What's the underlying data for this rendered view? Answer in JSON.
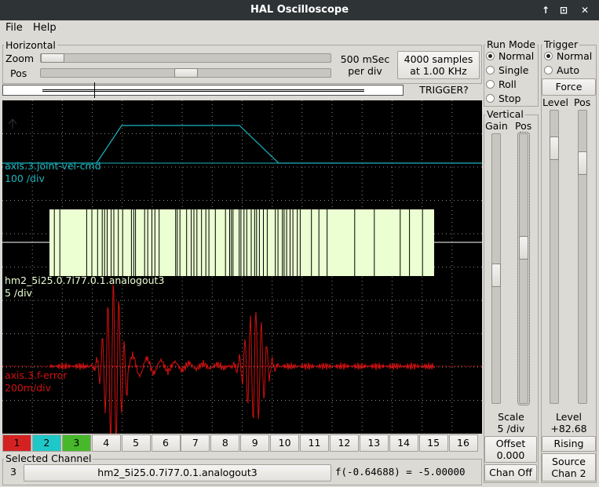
{
  "window": {
    "title": "HAL Oscilloscope",
    "buttons": [
      "↑",
      "⊡",
      "✕"
    ]
  },
  "menu": {
    "file": "File",
    "help": "Help"
  },
  "horizontal": {
    "label": "Horizontal",
    "zoom_label": "Zoom",
    "pos_label": "Pos",
    "rate_line1": "500 mSec",
    "rate_line2": "per div",
    "samples_line1": "4000 samples",
    "samples_line2": "at 1.00 KHz",
    "trigger_status": "TRIGGER?",
    "zoom_level": 0.0,
    "pos_level": 0.5
  },
  "run_mode": {
    "label": "Run Mode",
    "options": [
      "Normal",
      "Single",
      "Roll",
      "Stop"
    ],
    "selected": "Normal"
  },
  "trigger": {
    "label": "Trigger",
    "options": [
      "Normal",
      "Auto"
    ],
    "selected": "Normal",
    "force_label": "Force",
    "level_label": "Level",
    "pos_label": "Pos",
    "level_text": "Level",
    "level_value": "+82.68",
    "edge_label": "Rising",
    "source_line1": "Source",
    "source_line2": "Chan  2"
  },
  "vertical": {
    "label": "Vertical",
    "gain_label": "Gain",
    "pos_label": "Pos",
    "scale_label": "Scale",
    "scale_value": "5 /div",
    "offset_label": "Offset",
    "offset_value": "0.000",
    "chan_off_label": "Chan Off"
  },
  "traces": [
    {
      "name": "axis.3.joint-vel-cmd",
      "scale": "100 /div",
      "color": "#19b5c0"
    },
    {
      "name": "hm2_5i25.0.7i77.0.1.analogout3",
      "scale": "5 /div",
      "color": "#ecffd2"
    },
    {
      "name": "axis.3.f-error",
      "scale": "200m/div",
      "color": "#d21010"
    }
  ],
  "channels": {
    "labels": [
      "1",
      "2",
      "3",
      "4",
      "5",
      "6",
      "7",
      "8",
      "9",
      "10",
      "11",
      "12",
      "13",
      "14",
      "15",
      "16"
    ],
    "colors": [
      "#d42222",
      "#1fc8c8",
      "#47b82a"
    ]
  },
  "selected_channel": {
    "label": "Selected Channel",
    "number": "3",
    "name": "hm2_5i25.0.7i77.0.1.analogout3",
    "readout": "f(-0.64688) = -5.00000"
  }
}
